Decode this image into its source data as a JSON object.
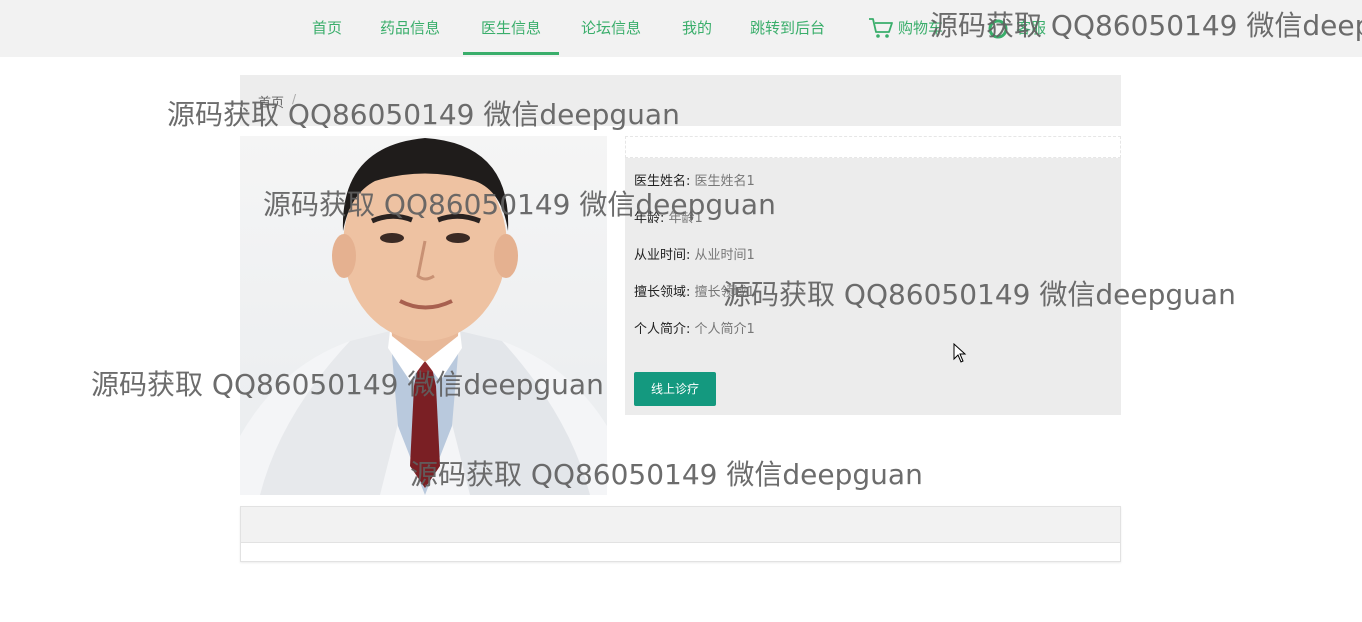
{
  "nav": {
    "items": [
      {
        "label": "首页"
      },
      {
        "label": "药品信息"
      },
      {
        "label": "医生信息"
      },
      {
        "label": "论坛信息"
      },
      {
        "label": "我的"
      },
      {
        "label": "跳转到后台"
      }
    ],
    "cart_label": "购物车",
    "service_label": "客服",
    "active_color": "#3aae6b"
  },
  "breadcrumb": {
    "home": "首页",
    "separator": "/"
  },
  "doctor": {
    "fields": [
      {
        "key": "医生姓名:",
        "value": "医生姓名1"
      },
      {
        "key": "年龄:",
        "value": "年龄1"
      },
      {
        "key": "从业时间:",
        "value": "从业时间1"
      },
      {
        "key": "擅长领域:",
        "value": "擅长领域1"
      },
      {
        "key": "个人简介:",
        "value": "个人简介1"
      }
    ],
    "consult_button": "线上诊疗",
    "button_color": "#14997f"
  },
  "watermark": "源码获取 QQ86050149 微信deepguan"
}
